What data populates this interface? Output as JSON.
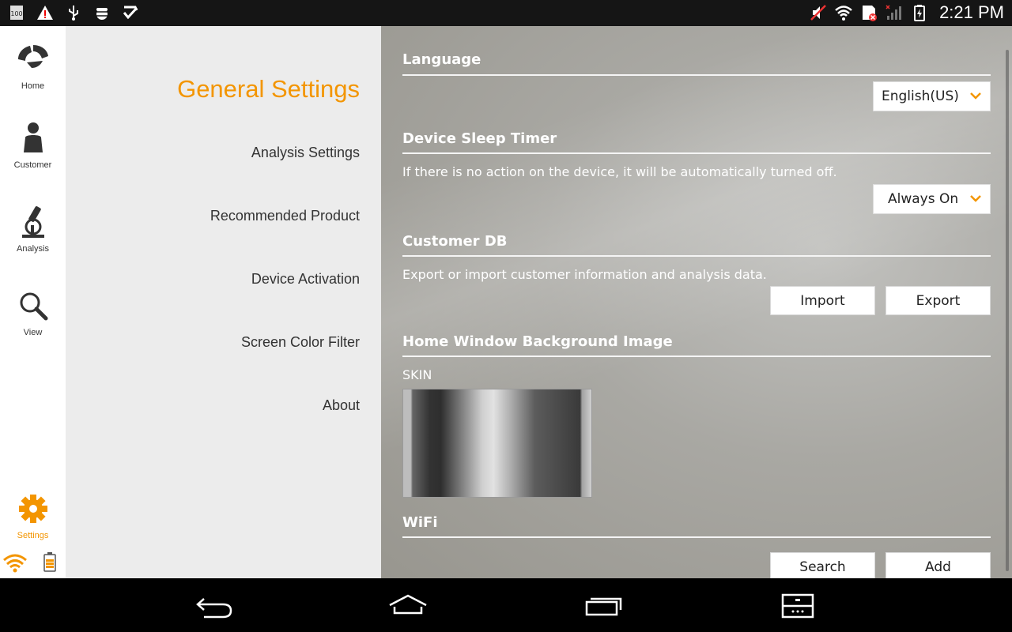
{
  "status_bar": {
    "time": "2:21 PM",
    "left_icons": [
      "storage-100-icon",
      "warning-icon",
      "usb-icon",
      "debug-bug-icon",
      "check-icon"
    ],
    "right_icons": [
      "mute-icon",
      "wifi-icon",
      "sim-error-icon",
      "signal-icon",
      "battery-charging-icon"
    ]
  },
  "rail": {
    "items": [
      {
        "label": "Home",
        "icon": "home-logo-icon"
      },
      {
        "label": "Customer",
        "icon": "person-icon"
      },
      {
        "label": "Analysis",
        "icon": "microscope-icon"
      },
      {
        "label": "View",
        "icon": "magnifier-icon"
      },
      {
        "label": "Settings",
        "icon": "gear-icon",
        "active": true
      }
    ],
    "accent": "#f39500"
  },
  "menu": {
    "title": "General Settings",
    "items": [
      "Analysis Settings",
      "Recommended Product",
      "Device Activation",
      "Screen Color Filter",
      "About"
    ]
  },
  "content": {
    "language": {
      "title": "Language",
      "selected": "English(US)"
    },
    "sleep": {
      "title": "Device Sleep Timer",
      "desc": "If there is no action on the device, it will be automatically turned off.",
      "selected": "Always On"
    },
    "db": {
      "title": "Customer DB",
      "desc": "Export or import customer information and analysis data.",
      "import_label": "Import",
      "export_label": "Export"
    },
    "background": {
      "title": "Home Window Background Image",
      "image_label": "SKIN"
    },
    "wifi": {
      "title": "WiFi",
      "search_label": "Search",
      "add_label": "Add"
    }
  },
  "navbar": {
    "icons": [
      "back-icon",
      "home-icon",
      "recents-icon",
      "menu-icon"
    ]
  }
}
